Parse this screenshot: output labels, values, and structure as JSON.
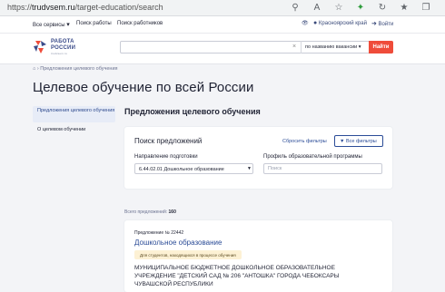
{
  "browser": {
    "url_prefix": "https://",
    "url_domain": "trudvsem.ru",
    "url_path": "/target-education/search"
  },
  "topnav": {
    "all_services": "Все сервисы",
    "job_search": "Поиск работы",
    "worker_search": "Поиск работников",
    "region": "Красноярский край",
    "login": "Войти"
  },
  "header": {
    "logo_line1": "РАБОТА",
    "logo_line2": "РОССИИ",
    "logo_sub": "trudvsem.ru",
    "search_value": "",
    "search_mode": "по названию вакансии",
    "search_button": "Найти"
  },
  "breadcrumb": {
    "current": "Предложения целевого обучения"
  },
  "page_title": "Целевое обучение по всей России",
  "sidebar": {
    "items": [
      {
        "label": "Предложения целевого обучения",
        "active": true
      },
      {
        "label": "О целевом обучении",
        "active": false
      }
    ]
  },
  "main": {
    "section_title": "Предложения целевого обучения",
    "search_card": {
      "title": "Поиск предложений",
      "reset_label": "Сбросить фильтры",
      "all_filters_label": "Все фильтры",
      "direction_label": "Направление подготовки",
      "direction_value": "6.44.02.01 Дошкольное образование",
      "profile_label": "Профиль образовательной программы",
      "profile_placeholder": "Поиск"
    },
    "total_label": "Всего предложений:",
    "total_value": "160",
    "vacancy": {
      "number": "Предложение № 22442",
      "title": "Дошкольное образование",
      "badge": "Для студентов, находящихся в процессе обучения",
      "org_line1": "МУНИЦИПАЛЬНОЕ БЮДЖЕТНОЕ ДОШКОЛЬНОЕ ОБРАЗОВАТЕЛЬНОЕ",
      "org_line2": "УЧРЕЖДЕНИЕ \"ДЕТСКИЙ САД № 206 \"АНТОШКА\" ГОРОДА ЧЕБОКСАРЫ",
      "org_line3": "ЧУВАШСКОЙ РЕСПУБЛИКИ"
    }
  },
  "colors": {
    "accent": "#ef4c3a",
    "link": "#2b4c97",
    "brand": "#3b4c8a"
  }
}
